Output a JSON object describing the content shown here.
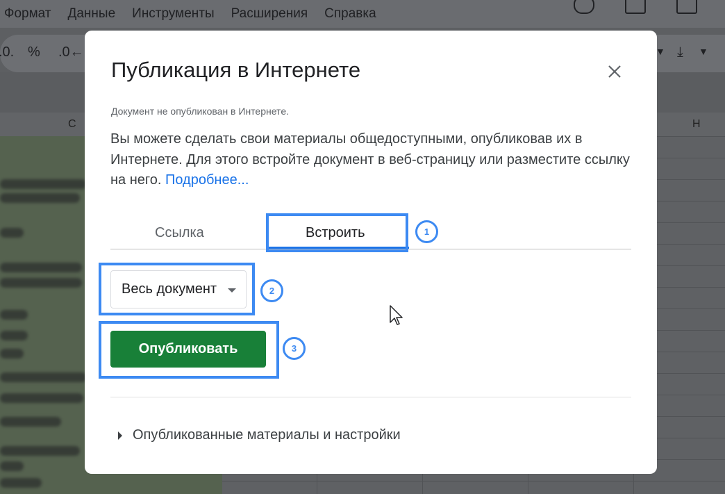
{
  "menu": [
    "Формат",
    "Данные",
    "Инструменты",
    "Расширения",
    "Справка"
  ],
  "toolbar": {
    "items": [
      ".0.",
      "%",
      ".0←"
    ]
  },
  "columns": [
    "C",
    "H"
  ],
  "dialog": {
    "title": "Публикация в Интернете",
    "status": "Документ не опубликован в Интернете.",
    "description": "Вы можете сделать свои материалы общедоступными, опубликовав их в Интернете. Для этого встройте документ в веб-страницу или разместите ссылку на него.",
    "learn_more": "Подробнее...",
    "tabs": [
      "Ссылка",
      "Встроить"
    ],
    "active_tab": "Встроить",
    "select_value": "Весь документ",
    "publish_label": "Опубликовать",
    "published_settings": "Опубликованные материалы и настройки"
  },
  "annotations": [
    "1",
    "2",
    "3"
  ],
  "colors": {
    "highlight": "#3d8af2",
    "publish": "#188038",
    "link": "#1a73e8"
  }
}
